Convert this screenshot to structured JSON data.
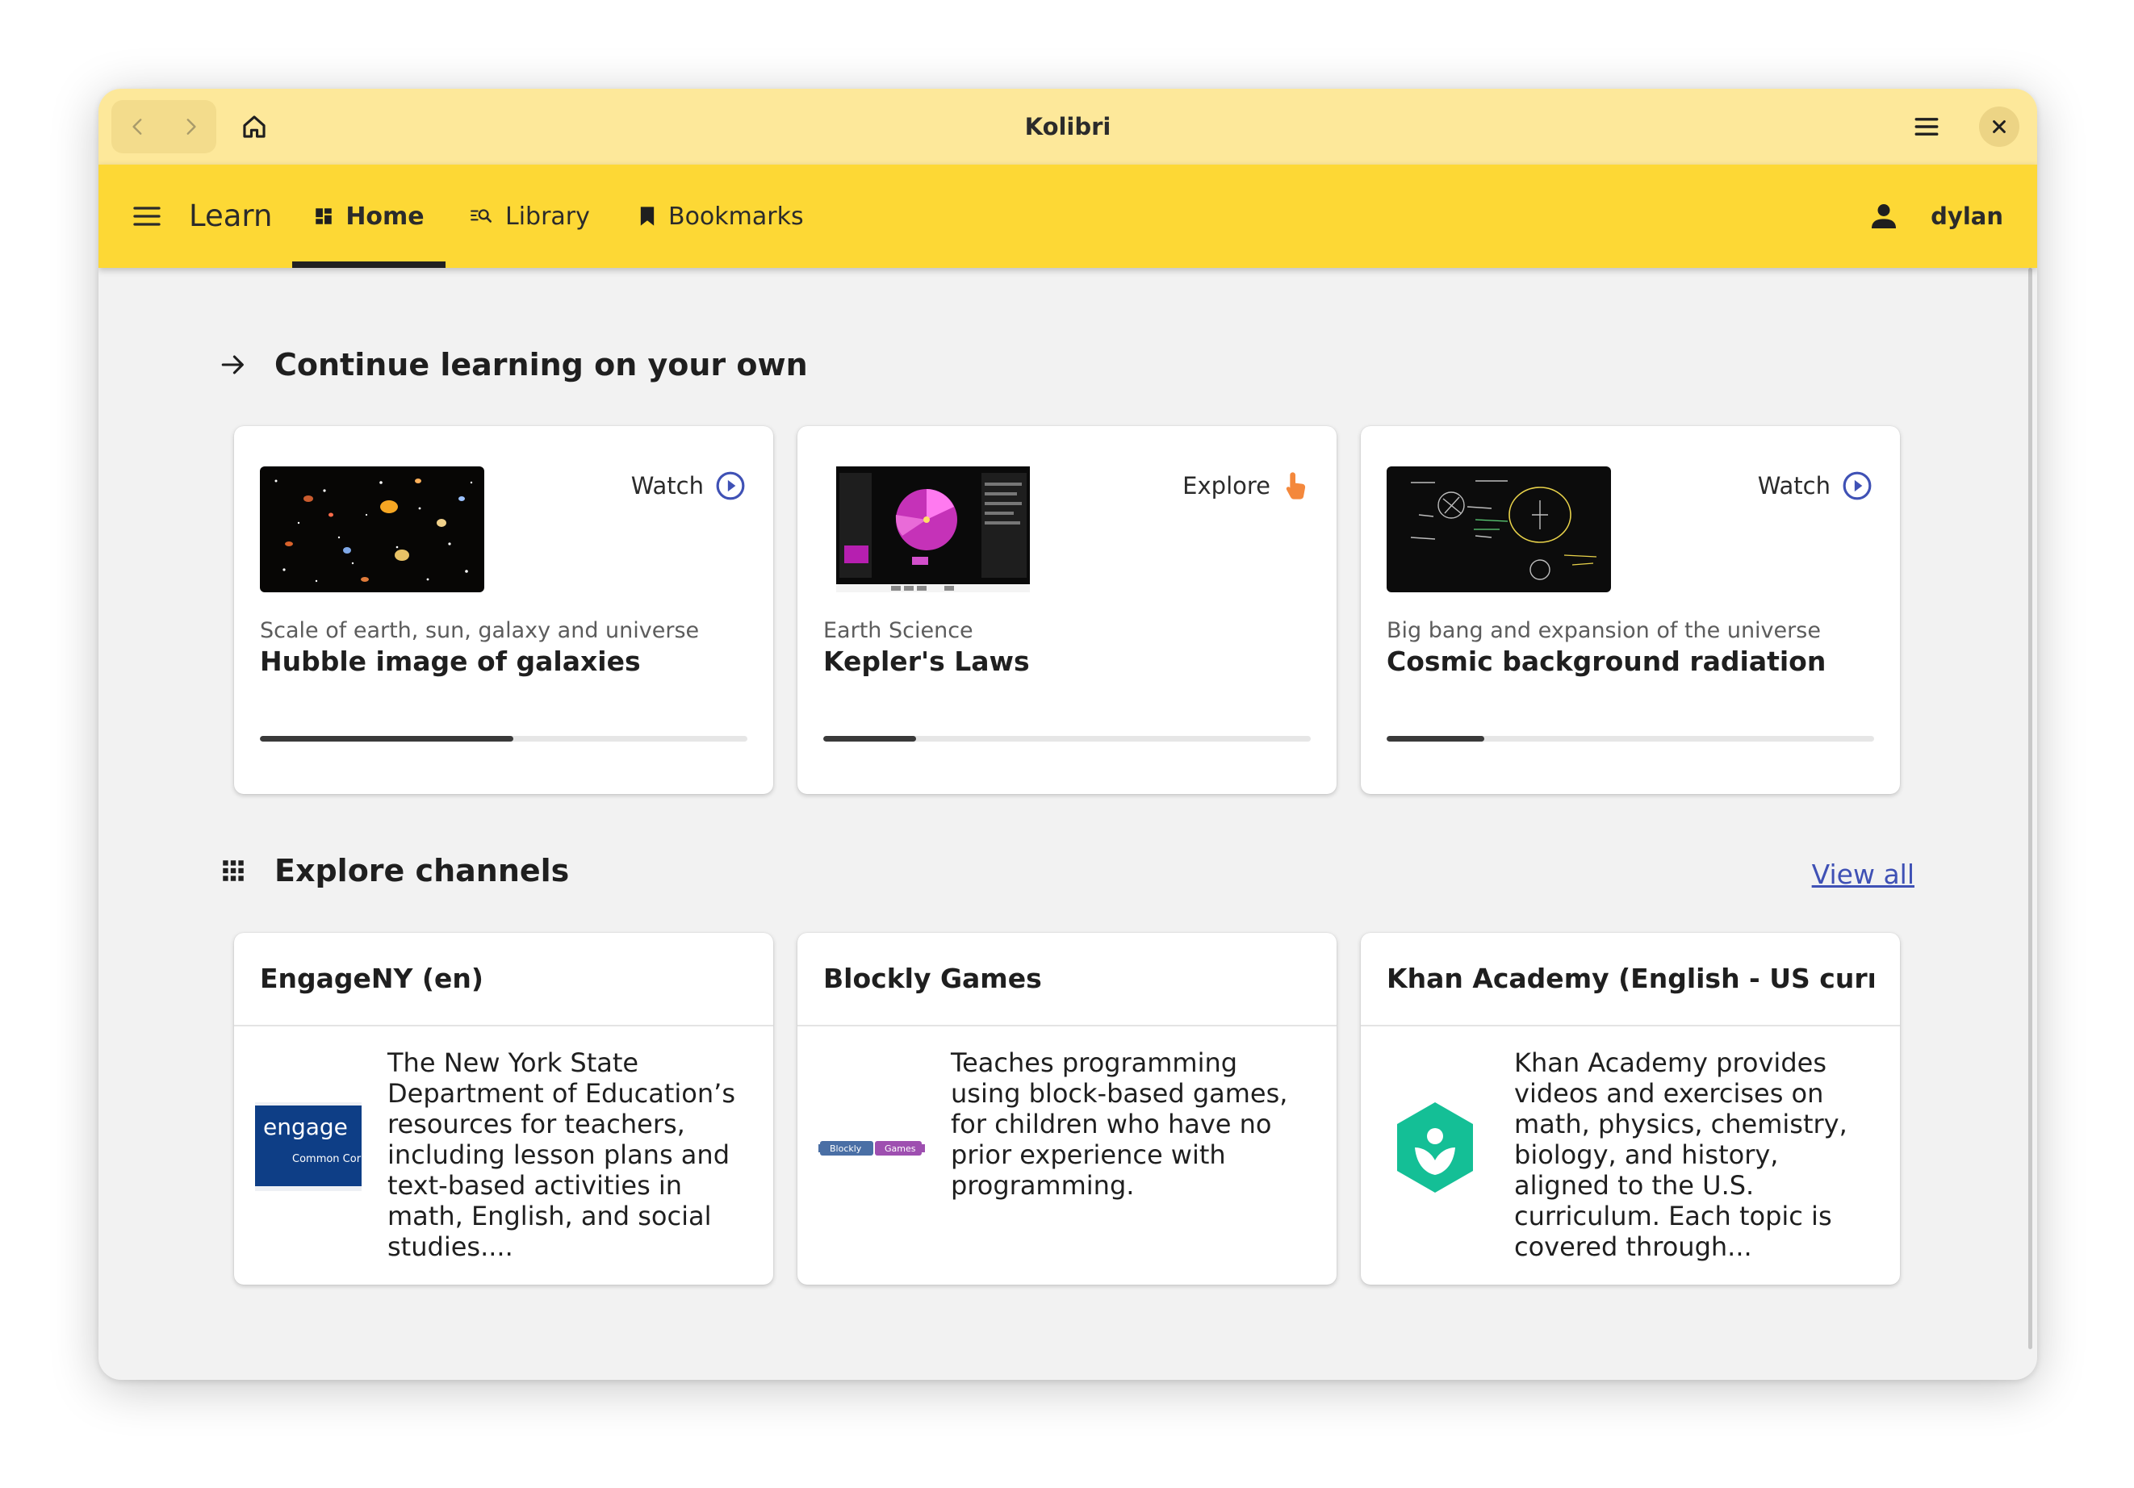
{
  "window": {
    "title": "Kolibri"
  },
  "appbar": {
    "title": "Learn",
    "tabs": [
      {
        "label": "Home",
        "active": true,
        "icon": "dashboard-icon"
      },
      {
        "label": "Library",
        "active": false,
        "icon": "library-search-icon"
      },
      {
        "label": "Bookmarks",
        "active": false,
        "icon": "bookmark-icon"
      }
    ],
    "user": "dylan"
  },
  "continue_section": {
    "heading": "Continue learning on your own",
    "cards": [
      {
        "kind": "Watch",
        "kind_icon": "play-circle-icon",
        "subtitle": "Scale of earth, sun, galaxy and universe",
        "title": "Hubble image of galaxies",
        "progress_pct": 52
      },
      {
        "kind": "Explore",
        "kind_icon": "pointer-hand-icon",
        "subtitle": "Earth Science",
        "title": "Kepler's Laws",
        "progress_pct": 19
      },
      {
        "kind": "Watch",
        "kind_icon": "play-circle-icon",
        "subtitle": "Big bang and expansion of the universe",
        "title": "Cosmic background radiation",
        "progress_pct": 20
      }
    ]
  },
  "channels_section": {
    "heading": "Explore channels",
    "view_all": "View all",
    "cards": [
      {
        "title": "EngageNY (en)",
        "logo_text": "engage",
        "logo_sub": "Common Cor",
        "description": "The New York State Department of Education’s resources for teachers, including lesson plans and text-based activities in math, English, and social studies...."
      },
      {
        "title": "Blockly Games",
        "logo_text": "Blockly",
        "logo_sub": "Games",
        "description": "Teaches programming using block-based games, for children who have no prior experience with programming."
      },
      {
        "title": "Khan Academy (English - US curric...",
        "logo_text": "",
        "logo_sub": "",
        "description": "Khan Academy provides videos and exercises on math, physics, chemistry, biology, and history, aligned to the U.S. curriculum. Each topic is covered through..."
      }
    ]
  },
  "colors": {
    "titlebar": "#fde89a",
    "appbar": "#fdd835",
    "link": "#3f51b5",
    "play_icon": "#3f51b5",
    "explore_icon": "#f4883c",
    "khan_green": "#14bf96"
  }
}
